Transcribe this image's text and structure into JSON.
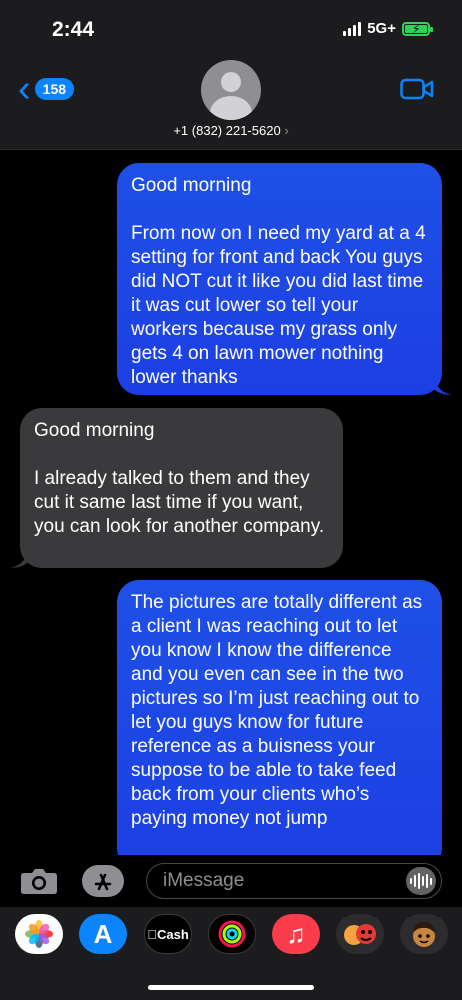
{
  "status": {
    "time": "2:44",
    "network": "5G+"
  },
  "header": {
    "unread_count": "158",
    "contact": "+1 (832) 221-5620",
    "contact_chevron": "›"
  },
  "messages": [
    {
      "direction": "sent",
      "text": "Good morning\n\nFrom now on I need my yard at a 4 setting for front and back You guys did NOT cut it like you did last time it was cut lower so tell your workers because my grass only gets 4 on lawn mower nothing lower thanks"
    },
    {
      "direction": "received",
      "text": "Good morning\n\nI already talked to them and they cut it same last time if you want, you can look for another company."
    },
    {
      "direction": "sent",
      "text": "The pictures are totally different as a client I was reaching out to let you know I know the difference and you even can see in the two pictures so I’m just reaching out to let you guys know for future reference as a buisness your suppose to be able to take feed back from your clients who’s paying money not jump"
    }
  ],
  "input": {
    "placeholder": "iMessage"
  },
  "app_tray": [
    {
      "icon": "photos-icon"
    },
    {
      "icon": "app-store-icon",
      "glyph": "A"
    },
    {
      "icon": "apple-cash-icon",
      "label": "Cash"
    },
    {
      "icon": "fitness-icon"
    },
    {
      "icon": "music-icon",
      "glyph": "♫"
    },
    {
      "icon": "memoji-stickers-icon"
    },
    {
      "icon": "memoji-icon"
    }
  ],
  "colors": {
    "accent": "#0a84ff",
    "sent_bubble": "#1f4fe5",
    "received_bubble": "#3a3a3c",
    "battery": "#30d158"
  }
}
